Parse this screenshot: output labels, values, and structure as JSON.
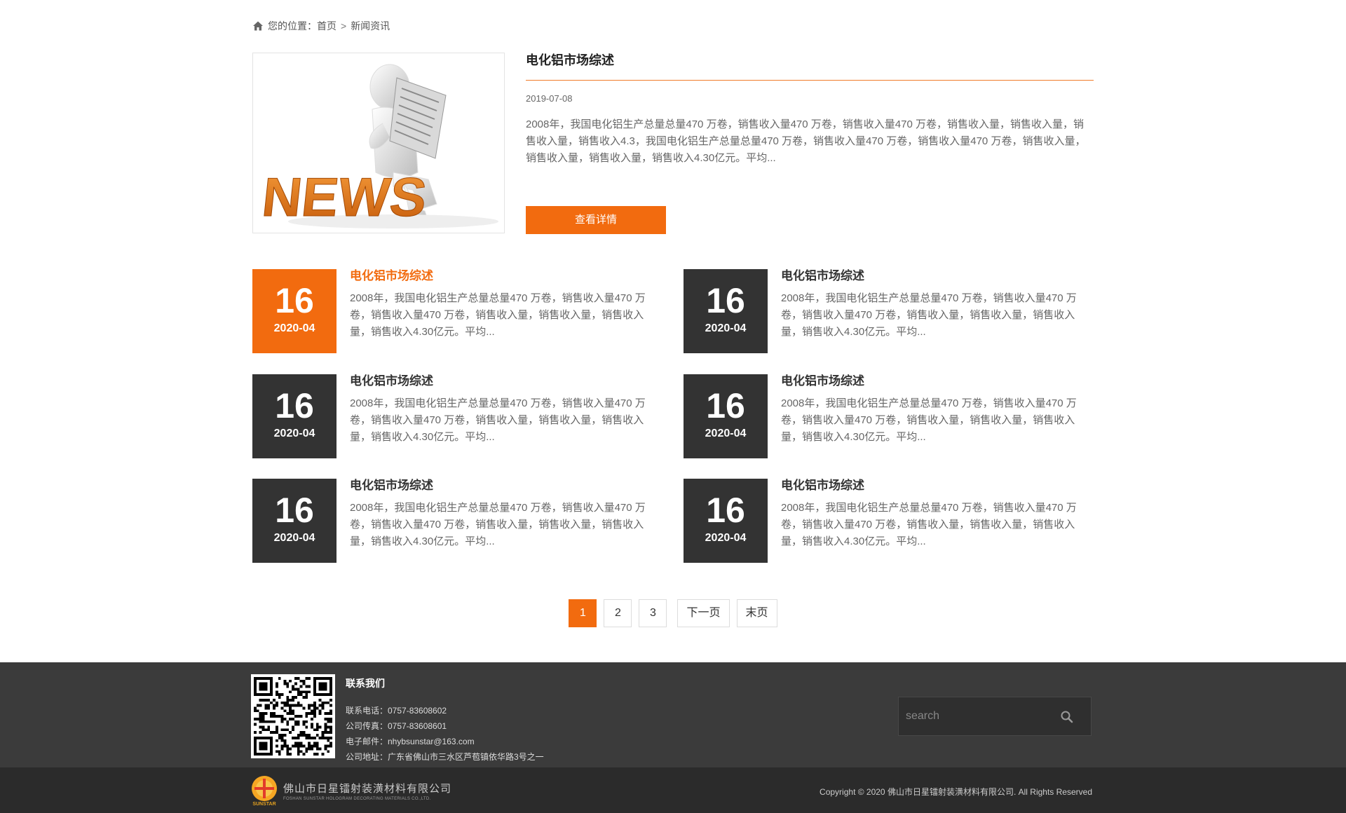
{
  "breadcrumb": {
    "prefix": "您的位置：",
    "home": "首页",
    "separator": ">",
    "current": "新闻资讯"
  },
  "featured": {
    "title": "电化铝市场综述",
    "date": "2019-07-08",
    "description": "2008年，我国电化铝生产总量总量470 万卷，销售收入量470 万卷，销售收入量470 万卷，销售收入量，销售收入量，销售收入量，销售收入4.3，我国电化铝生产总量总量470 万卷，销售收入量470 万卷，销售收入量470 万卷，销售收入量，销售收入量，销售收入量，销售收入4.30亿元。平均...",
    "button_label": "查看详情",
    "image_word": "NEWS"
  },
  "news": [
    {
      "day": "16",
      "ym": "2020-04",
      "title": "电化铝市场综述",
      "desc": "2008年，我国电化铝生产总量总量470 万卷，销售收入量470 万卷，销售收入量470 万卷，销售收入量，销售收入量，销售收入量，销售收入4.30亿元。平均...",
      "active": true
    },
    {
      "day": "16",
      "ym": "2020-04",
      "title": "电化铝市场综述",
      "desc": "2008年，我国电化铝生产总量总量470 万卷，销售收入量470 万卷，销售收入量470 万卷，销售收入量，销售收入量，销售收入量，销售收入4.30亿元。平均..."
    },
    {
      "day": "16",
      "ym": "2020-04",
      "title": "电化铝市场综述",
      "desc": "2008年，我国电化铝生产总量总量470 万卷，销售收入量470 万卷，销售收入量470 万卷，销售收入量，销售收入量，销售收入量，销售收入4.30亿元。平均..."
    },
    {
      "day": "16",
      "ym": "2020-04",
      "title": "电化铝市场综述",
      "desc": "2008年，我国电化铝生产总量总量470 万卷，销售收入量470 万卷，销售收入量470 万卷，销售收入量，销售收入量，销售收入量，销售收入4.30亿元。平均..."
    },
    {
      "day": "16",
      "ym": "2020-04",
      "title": "电化铝市场综述",
      "desc": "2008年，我国电化铝生产总量总量470 万卷，销售收入量470 万卷，销售收入量470 万卷，销售收入量，销售收入量，销售收入量，销售收入4.30亿元。平均..."
    },
    {
      "day": "16",
      "ym": "2020-04",
      "title": "电化铝市场综述",
      "desc": "2008年，我国电化铝生产总量总量470 万卷，销售收入量470 万卷，销售收入量470 万卷，销售收入量，销售收入量，销售收入量，销售收入4.30亿元。平均..."
    }
  ],
  "pagination": {
    "pages": [
      "1",
      "2",
      "3"
    ],
    "current": "1",
    "next": "下一页",
    "last": "末页"
  },
  "footer": {
    "contact_title": "联系我们",
    "phone": "联系电话：0757-83608602",
    "fax": "公司传真：0757-83608601",
    "email": "电子邮件：nhybsunstar@163.com",
    "address": "公司地址：广东省佛山市三水区芦苞镇依华路3号之一",
    "search_placeholder": "search",
    "company_cn": "佛山市日星镭射装潢材料有限公司",
    "company_en": "FOSHAN SUNSTAR HOLOGRAM DECORATING MATERIALS CO.,LTD.",
    "logo_text": "SUNSTAR",
    "copyright": "Copyright © 2020 佛山市日星镭射装潢材料有限公司. All Rights Reserved"
  },
  "colors": {
    "accent": "#f26b0f",
    "dark_box": "#333333",
    "footer_top": "#3b3b3b",
    "footer_bottom": "#2b2b2b"
  }
}
